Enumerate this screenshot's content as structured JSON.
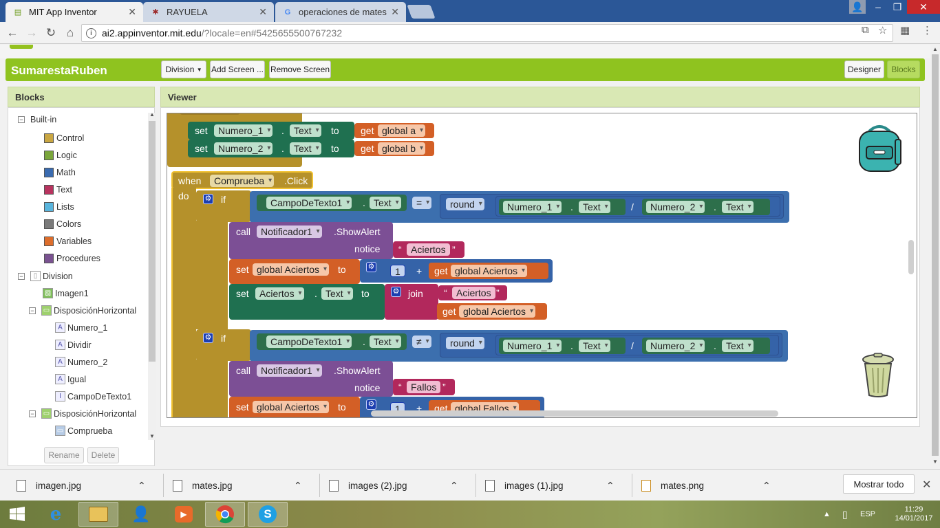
{
  "browser": {
    "tabs": [
      {
        "label": "MIT App Inventor",
        "icon": "app-inventor-icon",
        "active": true
      },
      {
        "label": "RAYUELA",
        "icon": "rayuela-icon",
        "active": false
      },
      {
        "label": "operaciones de mates fo",
        "icon": "google-icon",
        "active": false
      }
    ],
    "url_host": "ai2.appinventor.mit.edu",
    "url_path": "/?locale=en#5425655500767232"
  },
  "app": {
    "project_name": "SumarestaRuben",
    "screen_select": "Division",
    "add_screen": "Add Screen ...",
    "remove_screen": "Remove Screen",
    "designer": "Designer",
    "blocks": "Blocks"
  },
  "blocks_panel": {
    "title": "Blocks",
    "builtin_label": "Built-in",
    "builtin": [
      {
        "label": "Control",
        "color": "#c9a642"
      },
      {
        "label": "Logic",
        "color": "#7aa63b"
      },
      {
        "label": "Math",
        "color": "#3a6bb0"
      },
      {
        "label": "Text",
        "color": "#b8335f"
      },
      {
        "label": "Lists",
        "color": "#59b5dd"
      },
      {
        "label": "Colors",
        "color": "#7b7b7b"
      },
      {
        "label": "Variables",
        "color": "#dd6d2b"
      },
      {
        "label": "Procedures",
        "color": "#7a5291"
      }
    ],
    "screen_label": "Division",
    "components": [
      {
        "label": "Imagen1",
        "icon": "image-icon",
        "indent": 1
      },
      {
        "label": "DisposiciónHorizontal",
        "icon": "horizontal-arrangement-icon",
        "indent": 1,
        "toggle": "minus"
      },
      {
        "label": "Numero_1",
        "icon": "label-icon",
        "indent": 2
      },
      {
        "label": "Dividir",
        "icon": "label-icon",
        "indent": 2
      },
      {
        "label": "Numero_2",
        "icon": "label-icon",
        "indent": 2
      },
      {
        "label": "Igual",
        "icon": "label-icon",
        "indent": 2
      },
      {
        "label": "CampoDeTexto1",
        "icon": "textbox-icon",
        "indent": 2
      },
      {
        "label": "DisposiciónHorizontal",
        "icon": "horizontal-arrangement-icon",
        "indent": 1,
        "toggle": "minus"
      },
      {
        "label": "Comprueba",
        "icon": "button-icon",
        "indent": 2
      }
    ],
    "rename": "Rename",
    "delete": "Delete"
  },
  "viewer": {
    "title": "Viewer",
    "kw": {
      "set": "set",
      "to": "to",
      "get": "get",
      "dot": ".",
      "when": "when",
      "do": "do",
      "if": "if",
      "then": "then",
      "call": "call",
      "notice": "notice",
      "join": "join",
      "plus": "+",
      "divide": "/",
      "eq": "=",
      "neq": "≠",
      "quote_open": "“",
      "quote_close": "”"
    },
    "names": {
      "numero1": "Numero_1",
      "numero2": "Numero_2",
      "text": "Text",
      "global_a": "global a",
      "global_b": "global b",
      "comprueba": "Comprueba",
      "click": ".Click",
      "campo": "CampoDeTexto1",
      "round": "round",
      "notificador": "Notificador1",
      "showalert": ".ShowAlert",
      "aciertos_str": "Aciertos",
      "fallos_str": "Fallos",
      "global_aciertos": "global Aciertos",
      "global_fallos": "global Fallos",
      "aciertos_label": "Aciertos",
      "one": "1"
    }
  },
  "downloads": {
    "items": [
      "imagen.jpg",
      "mates.jpg",
      "images (2).jpg",
      "images (1).jpg",
      "mates.png"
    ],
    "show_all": "Mostrar todo"
  },
  "taskbar": {
    "lang": "ESP",
    "time": "11:29",
    "date": "14/01/2017"
  }
}
